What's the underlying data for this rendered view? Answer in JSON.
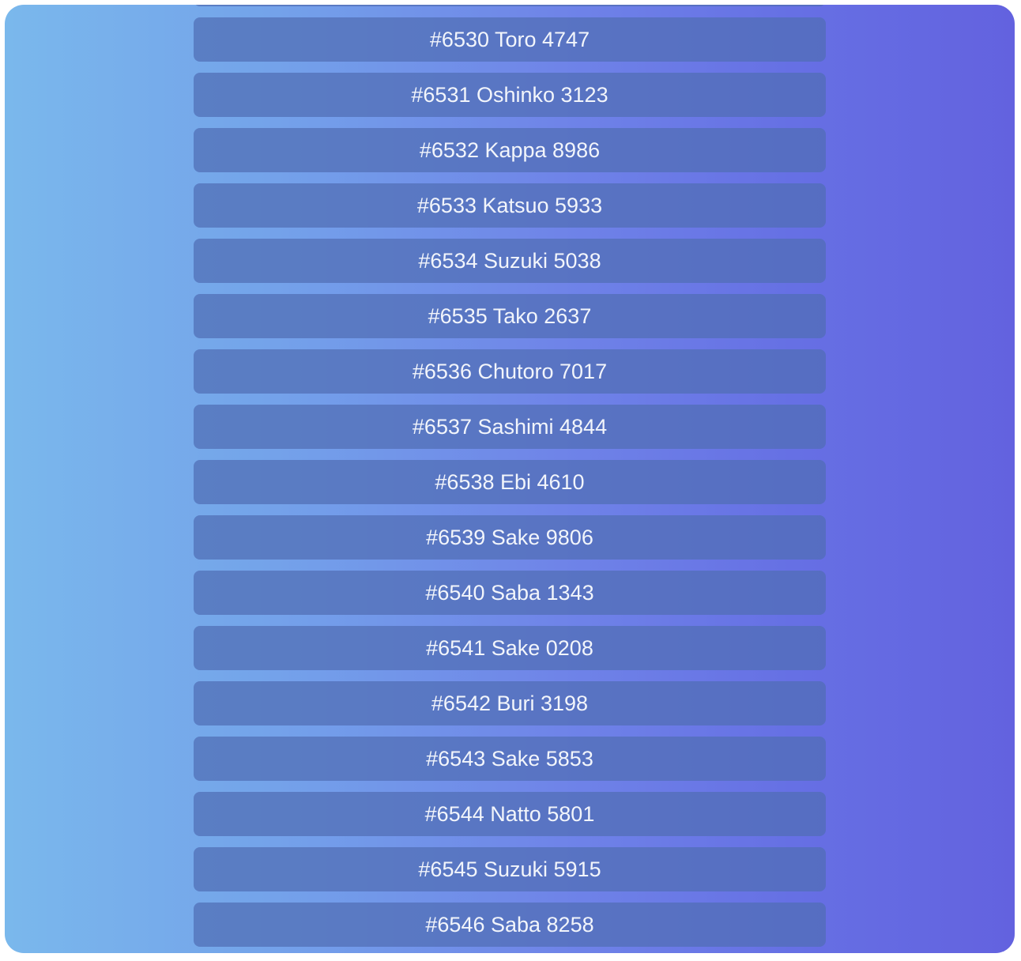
{
  "list": {
    "items": [
      {
        "label": ""
      },
      {
        "label": "#6530 Toro 4747"
      },
      {
        "label": "#6531 Oshinko 3123"
      },
      {
        "label": "#6532 Kappa 8986"
      },
      {
        "label": "#6533 Katsuo 5933"
      },
      {
        "label": "#6534 Suzuki 5038"
      },
      {
        "label": "#6535 Tako 2637"
      },
      {
        "label": "#6536 Chutoro 7017"
      },
      {
        "label": "#6537 Sashimi 4844"
      },
      {
        "label": "#6538 Ebi 4610"
      },
      {
        "label": "#6539 Sake 9806"
      },
      {
        "label": "#6540 Saba 1343"
      },
      {
        "label": "#6541 Sake 0208"
      },
      {
        "label": "#6542 Buri 3198"
      },
      {
        "label": "#6543 Sake 5853"
      },
      {
        "label": "#6544 Natto 5801"
      },
      {
        "label": "#6545 Suzuki 5915"
      },
      {
        "label": "#6546 Saba 8258"
      }
    ]
  },
  "colors": {
    "gradient_start": "#7ab8ec",
    "gradient_end": "#6362df",
    "item_background": "#506eb4",
    "item_text": "#f2f5fb"
  }
}
